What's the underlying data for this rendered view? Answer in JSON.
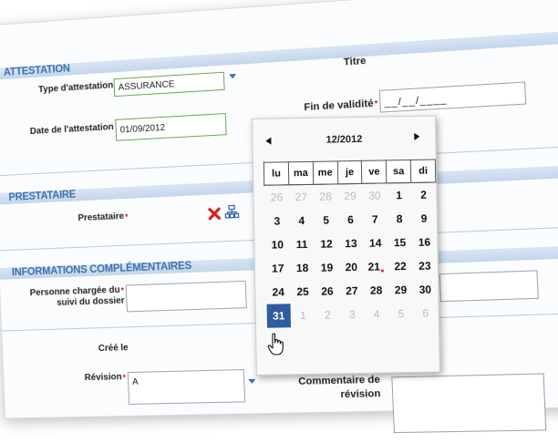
{
  "sections": {
    "attestation": {
      "title": "ATTESTATION",
      "type_label": "Type d'attestation",
      "type_value": "ASSURANCE",
      "date_label": "Date de l'attestation",
      "date_value": "01/09/2012",
      "titre_label": "Titre",
      "fin_label": "Fin de validité",
      "fin_value": "__/__/____"
    },
    "prestataire": {
      "title": "PRESTATAIRE",
      "label": "Prestataire"
    },
    "infos": {
      "title": "INFORMATIONS COMPLÉMENTAIRES",
      "person_label_1": "Personne chargée du",
      "person_label_2": "suivi du dossier",
      "cree_label": "Créé le",
      "revision_label": "Révision",
      "revision_value": "A",
      "comment_label_1": "Commentaire de",
      "comment_label_2": "révision"
    }
  },
  "required_mark": "*",
  "icons": {
    "delete": "close-icon",
    "tree": "hierarchy-icon",
    "dropdown": "chevron-down-icon",
    "prev": "arrow-left-icon",
    "next": "arrow-right-icon",
    "cursor": "hand-pointer-icon"
  },
  "colors": {
    "section_title": "#3b6fb0",
    "section_bar": "#d2e0f0",
    "required": "#cc2222",
    "selected_day": "#2f5c9e",
    "valid_border": "#6aa84f",
    "delete_icon": "#d32020"
  },
  "calendar": {
    "month": "12/2012",
    "weekdays": [
      "lu",
      "ma",
      "me",
      "je",
      "ve",
      "sa",
      "di"
    ],
    "weeks": [
      [
        {
          "d": "26",
          "m": true
        },
        {
          "d": "27",
          "m": true
        },
        {
          "d": "28",
          "m": true
        },
        {
          "d": "29",
          "m": true
        },
        {
          "d": "30",
          "m": true
        },
        {
          "d": "1"
        },
        {
          "d": "2"
        }
      ],
      [
        {
          "d": "3"
        },
        {
          "d": "4"
        },
        {
          "d": "5"
        },
        {
          "d": "6"
        },
        {
          "d": "7"
        },
        {
          "d": "8"
        },
        {
          "d": "9"
        }
      ],
      [
        {
          "d": "10"
        },
        {
          "d": "11"
        },
        {
          "d": "12"
        },
        {
          "d": "13"
        },
        {
          "d": "14"
        },
        {
          "d": "15"
        },
        {
          "d": "16"
        }
      ],
      [
        {
          "d": "17"
        },
        {
          "d": "18"
        },
        {
          "d": "19"
        },
        {
          "d": "20"
        },
        {
          "d": "21",
          "dot": true
        },
        {
          "d": "22"
        },
        {
          "d": "23"
        }
      ],
      [
        {
          "d": "24"
        },
        {
          "d": "25"
        },
        {
          "d": "26"
        },
        {
          "d": "27"
        },
        {
          "d": "28"
        },
        {
          "d": "29"
        },
        {
          "d": "30"
        }
      ],
      [
        {
          "d": "31",
          "sel": true
        },
        {
          "d": "1",
          "m": true
        },
        {
          "d": "2",
          "m": true
        },
        {
          "d": "3",
          "m": true
        },
        {
          "d": "4",
          "m": true
        },
        {
          "d": "5",
          "m": true
        },
        {
          "d": "6",
          "m": true
        }
      ]
    ]
  }
}
